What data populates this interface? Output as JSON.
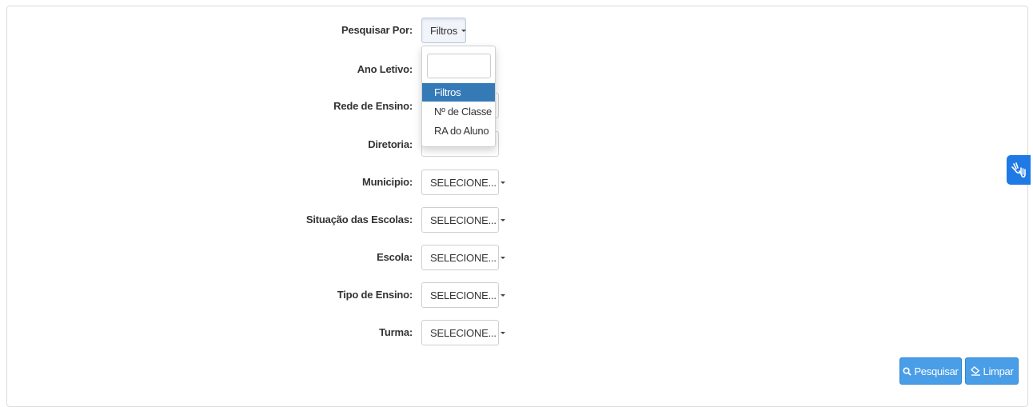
{
  "form": {
    "pesquisar_por": {
      "label": "Pesquisar Por:",
      "value": "Filtros"
    },
    "ano_letivo": {
      "label": "Ano Letivo:"
    },
    "rede_ensino": {
      "label": "Rede de Ensino:"
    },
    "diretoria": {
      "label": "Diretoria:"
    },
    "municipio": {
      "label": "Municipio:",
      "value": "SELECIONE..."
    },
    "situacao": {
      "label": "Situação das Escolas:",
      "value": "SELECIONE..."
    },
    "escola": {
      "label": "Escola:",
      "value": "SELECIONE..."
    },
    "tipo_ensino": {
      "label": "Tipo de Ensino:",
      "value": "SELECIONE..."
    },
    "turma": {
      "label": "Turma:",
      "value": "SELECIONE..."
    }
  },
  "dropdown_menu": {
    "search_value": "",
    "options": [
      "Filtros",
      "Nº de Classe",
      "RA do Aluno"
    ],
    "selected": "Filtros"
  },
  "buttons": {
    "pesquisar": "Pesquisar",
    "limpar": "Limpar"
  },
  "colors": {
    "primary_button": "#4a9ee8",
    "selected_option": "#337ab7",
    "accessibility_widget": "#1f7ae6"
  },
  "icons": {
    "pesquisar": "search-icon",
    "limpar": "eraser-icon",
    "accessibility": "sign-language-hands-icon"
  }
}
